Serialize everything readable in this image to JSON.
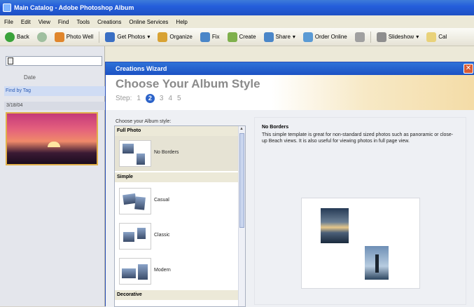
{
  "app": {
    "title": "Main Catalog - Adobe Photoshop Album",
    "menu": [
      "File",
      "Edit",
      "View",
      "Find",
      "Tools",
      "Creations",
      "Online Services",
      "Help"
    ],
    "toolbar": [
      {
        "label": "Back",
        "icon": "back-arrow-icon",
        "color": "#3aa33a"
      },
      {
        "label": "",
        "icon": "forward-arrow-icon",
        "color": "#3aa33a"
      },
      {
        "label": "Photo Well",
        "icon": "home-icon",
        "color": "#e0862c"
      },
      {
        "label": "Get Photos",
        "icon": "camera-icon",
        "color": "#3a6fc4"
      },
      {
        "label": "Organize",
        "icon": "organize-icon",
        "color": "#d8a233"
      },
      {
        "label": "Fix",
        "icon": "fix-icon",
        "color": "#4a86c8"
      },
      {
        "label": "Create",
        "icon": "create-icon",
        "color": "#7fb04c"
      },
      {
        "label": "Share",
        "icon": "share-icon",
        "color": "#4a86c8"
      },
      {
        "label": "Order Online",
        "icon": "order-icon",
        "color": "#5a9ad4"
      },
      {
        "label": "",
        "icon": "calendar-icon",
        "color": "#a0a0a0"
      },
      {
        "label": "Slideshow",
        "icon": "slideshow-icon",
        "color": "#8e8e8e"
      },
      {
        "label": "Cal",
        "icon": "calendar-view-icon",
        "color": "#e9d27a"
      }
    ]
  },
  "left_pane": {
    "date_label": "Date",
    "tag_text": "Find by Tag",
    "thumb_meta_left": "3/18/04",
    "thumb_meta_right": ""
  },
  "wizard": {
    "title": "Creations Wizard",
    "heading": "Choose Your Album Style",
    "step_label": "Step:",
    "steps": [
      "1",
      "2",
      "3",
      "4",
      "5"
    ],
    "current_step": "2",
    "choose_label": "Choose your Album style:",
    "categories": [
      {
        "name": "Full Photo",
        "items": [
          {
            "label": "No Borders",
            "selected": true
          }
        ]
      },
      {
        "name": "Simple",
        "items": [
          {
            "label": "Casual"
          },
          {
            "label": "Classic"
          },
          {
            "label": "Modern"
          }
        ]
      },
      {
        "name": "Decorative",
        "items": []
      }
    ],
    "preview": {
      "title": "No Borders",
      "description": "This simple template is great for non-standard sized photos such as panoramic or close-up Beach views. It is also useful for viewing photos in full page view."
    }
  }
}
